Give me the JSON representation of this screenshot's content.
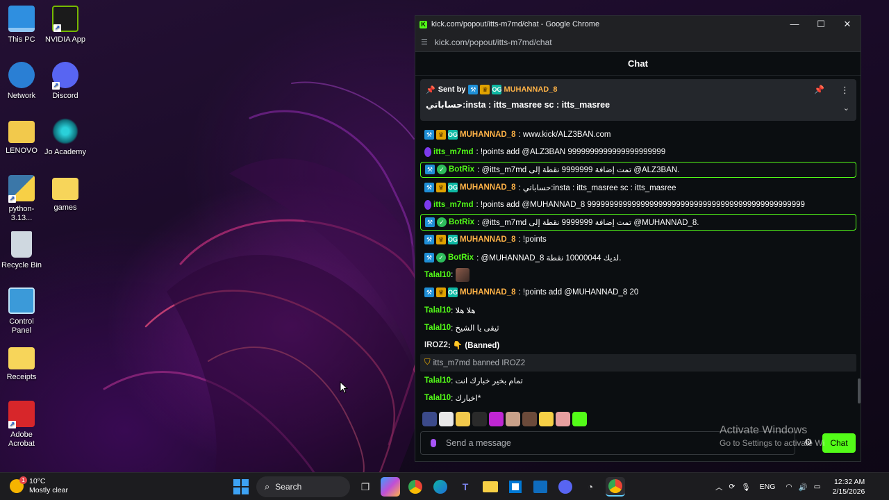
{
  "desktop": {
    "icons": [
      {
        "label": "This PC",
        "icon": "monitor-icon",
        "color": "#2f8fe0"
      },
      {
        "label": "NVIDIA App",
        "icon": "nvidia-icon",
        "color": "#1b1b1b"
      },
      {
        "label": "Network",
        "icon": "network-globe-icon",
        "color": "#2a7fd4"
      },
      {
        "label": "Discord",
        "icon": "discord-icon",
        "color": "#5865f2"
      },
      {
        "label": "LENOVO",
        "icon": "folder-icon",
        "color": "#f2c94c"
      },
      {
        "label": "Jo Academy",
        "icon": "jo-academy-icon",
        "color": "#0e6f7a"
      },
      {
        "label": "python-3.13...",
        "icon": "python-installer-icon",
        "color": "#3b77a8"
      },
      {
        "label": "games",
        "icon": "folder-icon",
        "color": "#f7d55a"
      },
      {
        "label": "Recycle Bin",
        "icon": "recycle-bin-icon",
        "color": "#cfd8e0"
      },
      {
        "label": "Control Panel",
        "icon": "control-panel-icon",
        "color": "#3b9ad9"
      },
      {
        "label": "Receipts",
        "icon": "folder-icon",
        "color": "#f7d55a"
      },
      {
        "label": "Adobe Acrobat",
        "icon": "adobe-acrobat-icon",
        "color": "#d7262a"
      }
    ]
  },
  "window": {
    "title": "kick.com/popout/itts-m7md/chat - Google Chrome",
    "url": "kick.com/popout/itts-m7md/chat",
    "controls": {
      "minimize": "—",
      "maximize": "☐",
      "close": "✕"
    }
  },
  "chat": {
    "header": "Chat",
    "pinned": {
      "sent_by_label": "Sent by",
      "user": "MUHANNAD_8",
      "text": "حساباتي:insta : itts_masree sc : itts_masree"
    },
    "messages": [
      {
        "user": "MUHANNAD_8",
        "text": ": www.kick/ALZ3BAN.com"
      },
      {
        "user": "itts_m7md",
        "text": ": !points add @ALZ3BAN 9999999999999999999999"
      },
      {
        "user": "BotRix",
        "text": ": @itts_m7md تمت إضافة 9999999 نقطة إلى @ALZ3BAN."
      },
      {
        "user": "MUHANNAD_8",
        "text": ": حساباتي:insta : itts_masree sc : itts_masree"
      },
      {
        "user": "itts_m7md",
        "text": ": !points add @MUHANNAD_8 9999999999999999999999999999999999999999999999999"
      },
      {
        "user": "BotRix",
        "text": ": @itts_m7md تمت إضافة 9999999 نقطة إلى @MUHANNAD_8."
      },
      {
        "user": "MUHANNAD_8",
        "text": ": !points"
      },
      {
        "user": "BotRix",
        "text": ": @MUHANNAD_8 لديك 10000044 نقطة."
      },
      {
        "user": "Talal10",
        "text": ":"
      },
      {
        "user": "MUHANNAD_8",
        "text": ": !points add @MUHANNAD_8 20"
      },
      {
        "user": "Talal10",
        "text": ": هلا هلا"
      },
      {
        "user": "Talal10",
        "text": ": ثيقى يا الشيخ"
      },
      {
        "user": "IROZ2",
        "text": ": 👇 (Banned)"
      },
      {
        "user": "itts_m7md",
        "text": "banned IROZ2"
      },
      {
        "user": "Talal10",
        "text": ": تمام بخير خبارك انت"
      },
      {
        "user": "Talal10",
        "text": ": اخبارك*"
      }
    ],
    "input_placeholder": "Send a message",
    "send_label": "Chat"
  },
  "watermark": {
    "line1": "Activate Windows",
    "line2": "Go to Settings to activate Wi"
  },
  "taskbar": {
    "weather_temp": "10°C",
    "weather_desc": "Mostly clear",
    "weather_badge": "1",
    "search_label": "Search",
    "language": "ENG",
    "time": "12:32 AM",
    "date": "2/15/2026"
  },
  "colors": {
    "kick_green": "#53fc18",
    "muhannad_orange": "#ffb347"
  }
}
